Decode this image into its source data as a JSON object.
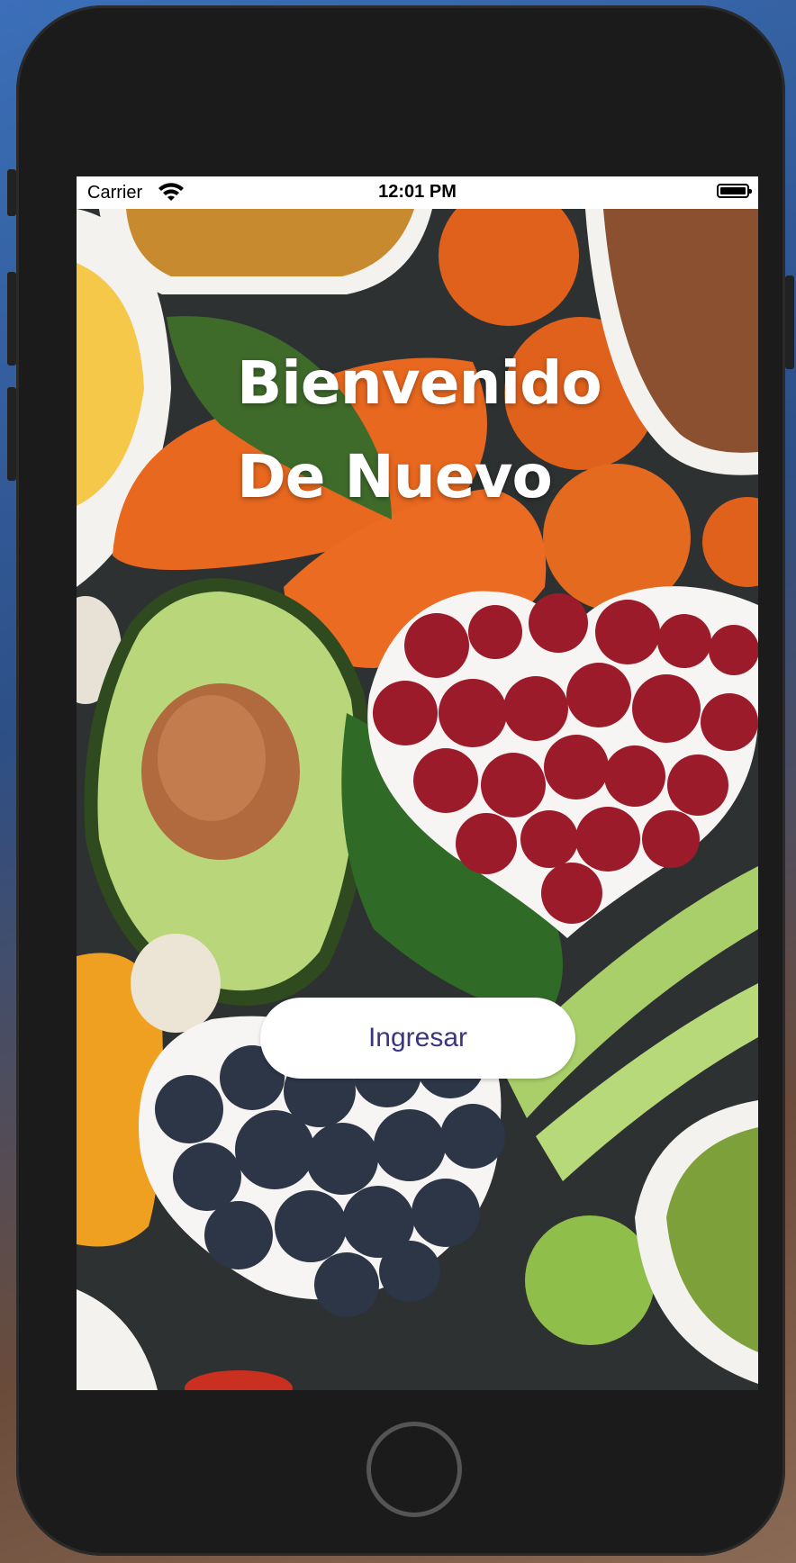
{
  "status_bar": {
    "carrier": "Carrier",
    "time": "12:01 PM",
    "icons": [
      "wifi-icon",
      "battery-icon"
    ]
  },
  "welcome": {
    "title_line1": "Bienvenido",
    "title_line2": "De Nuevo"
  },
  "login_button": {
    "label": "Ingresar"
  },
  "colors": {
    "button_text": "#3a3680",
    "button_bg": "#ffffff",
    "title_text": "#ffffff"
  }
}
